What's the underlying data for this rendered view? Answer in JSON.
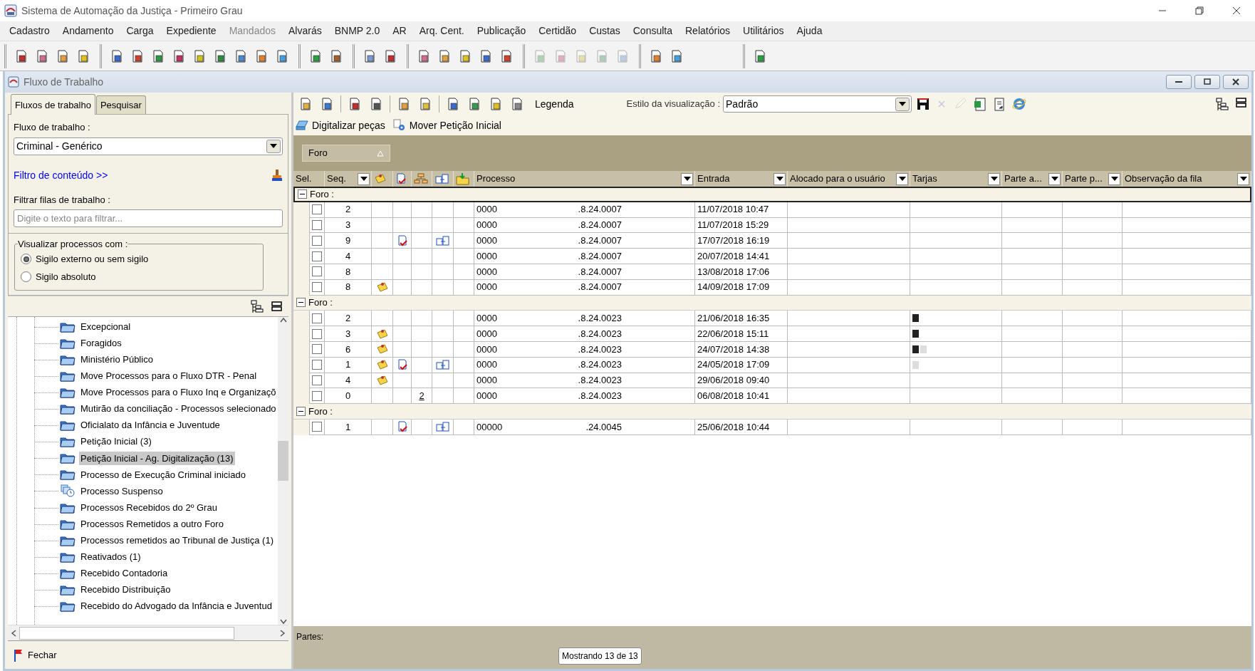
{
  "window": {
    "title": "Sistema de Automação da Justiça - Primeiro Grau"
  },
  "menu": [
    {
      "label": "Cadastro",
      "disabled": false
    },
    {
      "label": "Andamento",
      "disabled": false
    },
    {
      "label": "Carga",
      "disabled": false
    },
    {
      "label": "Expediente",
      "disabled": false
    },
    {
      "label": "Mandados",
      "disabled": true
    },
    {
      "label": "Alvarás",
      "disabled": false
    },
    {
      "label": "BNMP 2.0",
      "disabled": false
    },
    {
      "label": "AR",
      "disabled": false
    },
    {
      "label": "Arq. Cent.",
      "disabled": false
    },
    {
      "label": "Publicação",
      "disabled": false
    },
    {
      "label": "Certidão",
      "disabled": false
    },
    {
      "label": "Custas",
      "disabled": false
    },
    {
      "label": "Consulta",
      "disabled": false
    },
    {
      "label": "Relatórios",
      "disabled": false
    },
    {
      "label": "Utilitários",
      "disabled": false
    },
    {
      "label": "Ajuda",
      "disabled": false
    }
  ],
  "toolbar": [
    [
      {
        "disabled": false
      },
      {
        "disabled": false
      },
      {
        "disabled": false
      },
      {
        "disabled": false
      }
    ],
    [
      {
        "disabled": false
      },
      {
        "disabled": false
      },
      {
        "disabled": false
      },
      {
        "disabled": false
      },
      {
        "disabled": false
      },
      {
        "disabled": false
      },
      {
        "disabled": false
      },
      {
        "disabled": false
      },
      {
        "disabled": false
      }
    ],
    [
      {
        "disabled": false
      },
      {
        "disabled": false
      }
    ],
    [
      {
        "disabled": false
      },
      {
        "disabled": false
      }
    ],
    [
      {
        "disabled": false
      },
      {
        "disabled": false
      },
      {
        "disabled": false
      },
      {
        "disabled": false
      },
      {
        "disabled": false
      }
    ],
    [
      {
        "disabled": true
      },
      {
        "disabled": true
      },
      {
        "disabled": true
      },
      {
        "disabled": true
      },
      {
        "disabled": true
      }
    ],
    [
      {
        "disabled": false
      },
      {
        "disabled": false
      }
    ],
    [
      {
        "disabled": false
      }
    ]
  ],
  "child_window": {
    "title": "Fluxo de Trabalho"
  },
  "left_panel": {
    "tabs": [
      {
        "label": "Fluxos de trabalho",
        "selected": true
      },
      {
        "label": "Pesquisar",
        "selected": false
      }
    ],
    "workflow_label": "Fluxo de trabalho :",
    "workflow_value": "Criminal - Genérico",
    "content_filter_link": "Filtro de conteúdo >>",
    "queue_filter_label": "Filtrar filas de trabalho :",
    "queue_filter": {
      "placeholder": "Digite o texto para filtrar..."
    },
    "visibility": {
      "legend": "Visualizar processos com :",
      "options": [
        {
          "label": "Sigilo externo ou sem sigilo",
          "selected": true
        },
        {
          "label": "Sigilo absoluto",
          "selected": false
        }
      ]
    },
    "queues": [
      {
        "label": "Excepcional",
        "kind": "folder",
        "selected": false
      },
      {
        "label": "Foragidos",
        "kind": "folder",
        "selected": false
      },
      {
        "label": "Ministério Público",
        "kind": "folder",
        "selected": false
      },
      {
        "label": "Move Processos para o Fluxo DTR - Penal",
        "kind": "folder",
        "selected": false
      },
      {
        "label": "Move Processos para o Fluxo Inq e Organizaçõ",
        "kind": "folder",
        "selected": false
      },
      {
        "label": "Mutirão da conciliação - Processos selecionado",
        "kind": "folder",
        "selected": false
      },
      {
        "label": "Oficialato da Infância e Juventude",
        "kind": "folder",
        "selected": false
      },
      {
        "label": "Petição Inicial (3)",
        "kind": "folder",
        "selected": false
      },
      {
        "label": "Petição Inicial - Ag. Digitalização (13)",
        "kind": "folder",
        "selected": true
      },
      {
        "label": "Processo de Execução Criminal iniciado",
        "kind": "folder",
        "selected": false
      },
      {
        "label": "Processo Suspenso",
        "kind": "clock",
        "selected": false
      },
      {
        "label": "Processos Recebidos do 2º Grau",
        "kind": "folder",
        "selected": false
      },
      {
        "label": "Processos Remetidos a outro Foro",
        "kind": "folder",
        "selected": false
      },
      {
        "label": "Processos remetidos ao Tribunal de Justiça (1)",
        "kind": "folder",
        "selected": false
      },
      {
        "label": "Reativados (1)",
        "kind": "folder",
        "selected": false
      },
      {
        "label": "Recebido Contadoria",
        "kind": "folder",
        "selected": false
      },
      {
        "label": "Recebido Distribuição",
        "kind": "folder",
        "selected": false
      },
      {
        "label": "Recebido do Advogado da Infância e Juventud",
        "kind": "folder",
        "selected": false
      }
    ],
    "close_button": "Fechar"
  },
  "right_panel": {
    "legend_button": "Legenda",
    "view_style_label": "Estilo da visualização :",
    "view_style_value": "Padrão",
    "style_tools": [
      {
        "disabled": false
      },
      {
        "disabled": true
      },
      {
        "disabled": true
      },
      {
        "disabled": false
      },
      {
        "disabled": false
      },
      {
        "disabled": false
      }
    ],
    "actions": [
      "Digitalizar peças",
      "Mover Petição Inicial"
    ],
    "group_by": "Foro",
    "columns": [
      {
        "kind": "text",
        "label": "Sel.",
        "filter": false
      },
      {
        "kind": "text",
        "label": "Seq.",
        "filter": true
      },
      {
        "kind": "icon"
      },
      {
        "kind": "icon"
      },
      {
        "kind": "icon"
      },
      {
        "kind": "icon"
      },
      {
        "kind": "icon"
      },
      {
        "kind": "text",
        "label": "Processo",
        "filter": true
      },
      {
        "kind": "text",
        "label": "Entrada",
        "filter": true
      },
      {
        "kind": "text",
        "label": "Alocado para o usuário",
        "filter": true
      },
      {
        "kind": "text",
        "label": "Tarjas",
        "filter": true
      },
      {
        "kind": "text",
        "label": "Parte a...",
        "filter": true
      },
      {
        "kind": "text",
        "label": "Parte p...",
        "filter": true
      },
      {
        "kind": "text",
        "label": "Observação da fila",
        "filter": true
      }
    ],
    "groups": [
      {
        "label": "Foro :",
        "expanded": true,
        "rows": [
          {
            "checked": false,
            "seq": "2",
            "note": false,
            "attachment": false,
            "link": false,
            "process_start": "0000",
            "process_end": ".8.24.0007",
            "entry": "11/07/2018 10:47"
          },
          {
            "checked": false,
            "seq": "3",
            "note": false,
            "attachment": false,
            "link": false,
            "process_start": "0000",
            "process_end": ".8.24.0007",
            "entry": "11/07/2018 15:29"
          },
          {
            "checked": false,
            "seq": "9",
            "note": false,
            "attachment": true,
            "link": true,
            "process_start": "0000",
            "process_end": ".8.24.0007",
            "entry": "17/07/2018 16:19"
          },
          {
            "checked": false,
            "seq": "4",
            "note": false,
            "attachment": false,
            "link": false,
            "process_start": "0000",
            "process_end": ".8.24.0007",
            "entry": "20/07/2018 14:41"
          },
          {
            "checked": false,
            "seq": "8",
            "note": false,
            "attachment": false,
            "link": false,
            "process_start": "0000",
            "process_end": ".8.24.0007",
            "entry": "13/08/2018 17:06"
          },
          {
            "checked": false,
            "seq": "8",
            "note": true,
            "attachment": false,
            "link": false,
            "process_start": "0000",
            "process_end": ".8.24.0007",
            "entry": "14/09/2018 17:09"
          }
        ]
      },
      {
        "label": "Foro :",
        "expanded": true,
        "rows": [
          {
            "checked": false,
            "seq": "2",
            "note": false,
            "attachment": false,
            "link": false,
            "process_start": "0000",
            "process_end": ".8.24.0023",
            "entry": "21/06/2018 16:35",
            "tarjas": [
              {
                "color": "#222222"
              }
            ]
          },
          {
            "checked": false,
            "seq": "3",
            "note": true,
            "attachment": false,
            "link": false,
            "process_start": "0000",
            "process_end": ".8.24.0023",
            "entry": "22/06/2018 15:11",
            "tarjas": [
              {
                "color": "#222222"
              }
            ]
          },
          {
            "checked": false,
            "seq": "6",
            "note": true,
            "attachment": false,
            "link": false,
            "process_start": "0000",
            "process_end": ".8.24.0023",
            "entry": "24/07/2018 14:38",
            "tarjas": [
              {
                "color": "#222222"
              },
              {
                "color": "#dddddd"
              }
            ]
          },
          {
            "checked": false,
            "seq": "1",
            "note": true,
            "attachment": true,
            "link": true,
            "process_start": "0000",
            "process_end": ".8.24.0023",
            "entry": "24/05/2018 17:09",
            "tarjas": [
              {
                "color": "#dddddd"
              }
            ]
          },
          {
            "checked": false,
            "seq": "4",
            "note": true,
            "attachment": false,
            "link": false,
            "process_start": "0000",
            "process_end": ".8.24.0023",
            "entry": "29/06/2018 09:40"
          },
          {
            "checked": false,
            "seq": "0",
            "note": false,
            "attachment": false,
            "link": false,
            "count": "2",
            "process_start": "0000",
            "process_end": ".8.24.0023",
            "entry": "06/08/2018 10:41"
          }
        ]
      },
      {
        "label": "Foro :",
        "expanded": true,
        "rows": [
          {
            "checked": false,
            "seq": "1",
            "note": false,
            "attachment": true,
            "link": true,
            "process_start": "00000",
            "process_end": ".24.0045",
            "entry": "25/06/2018 10:44"
          }
        ]
      }
    ],
    "parts_label": "Partes:",
    "count": "Mostrando 13 de 13"
  }
}
